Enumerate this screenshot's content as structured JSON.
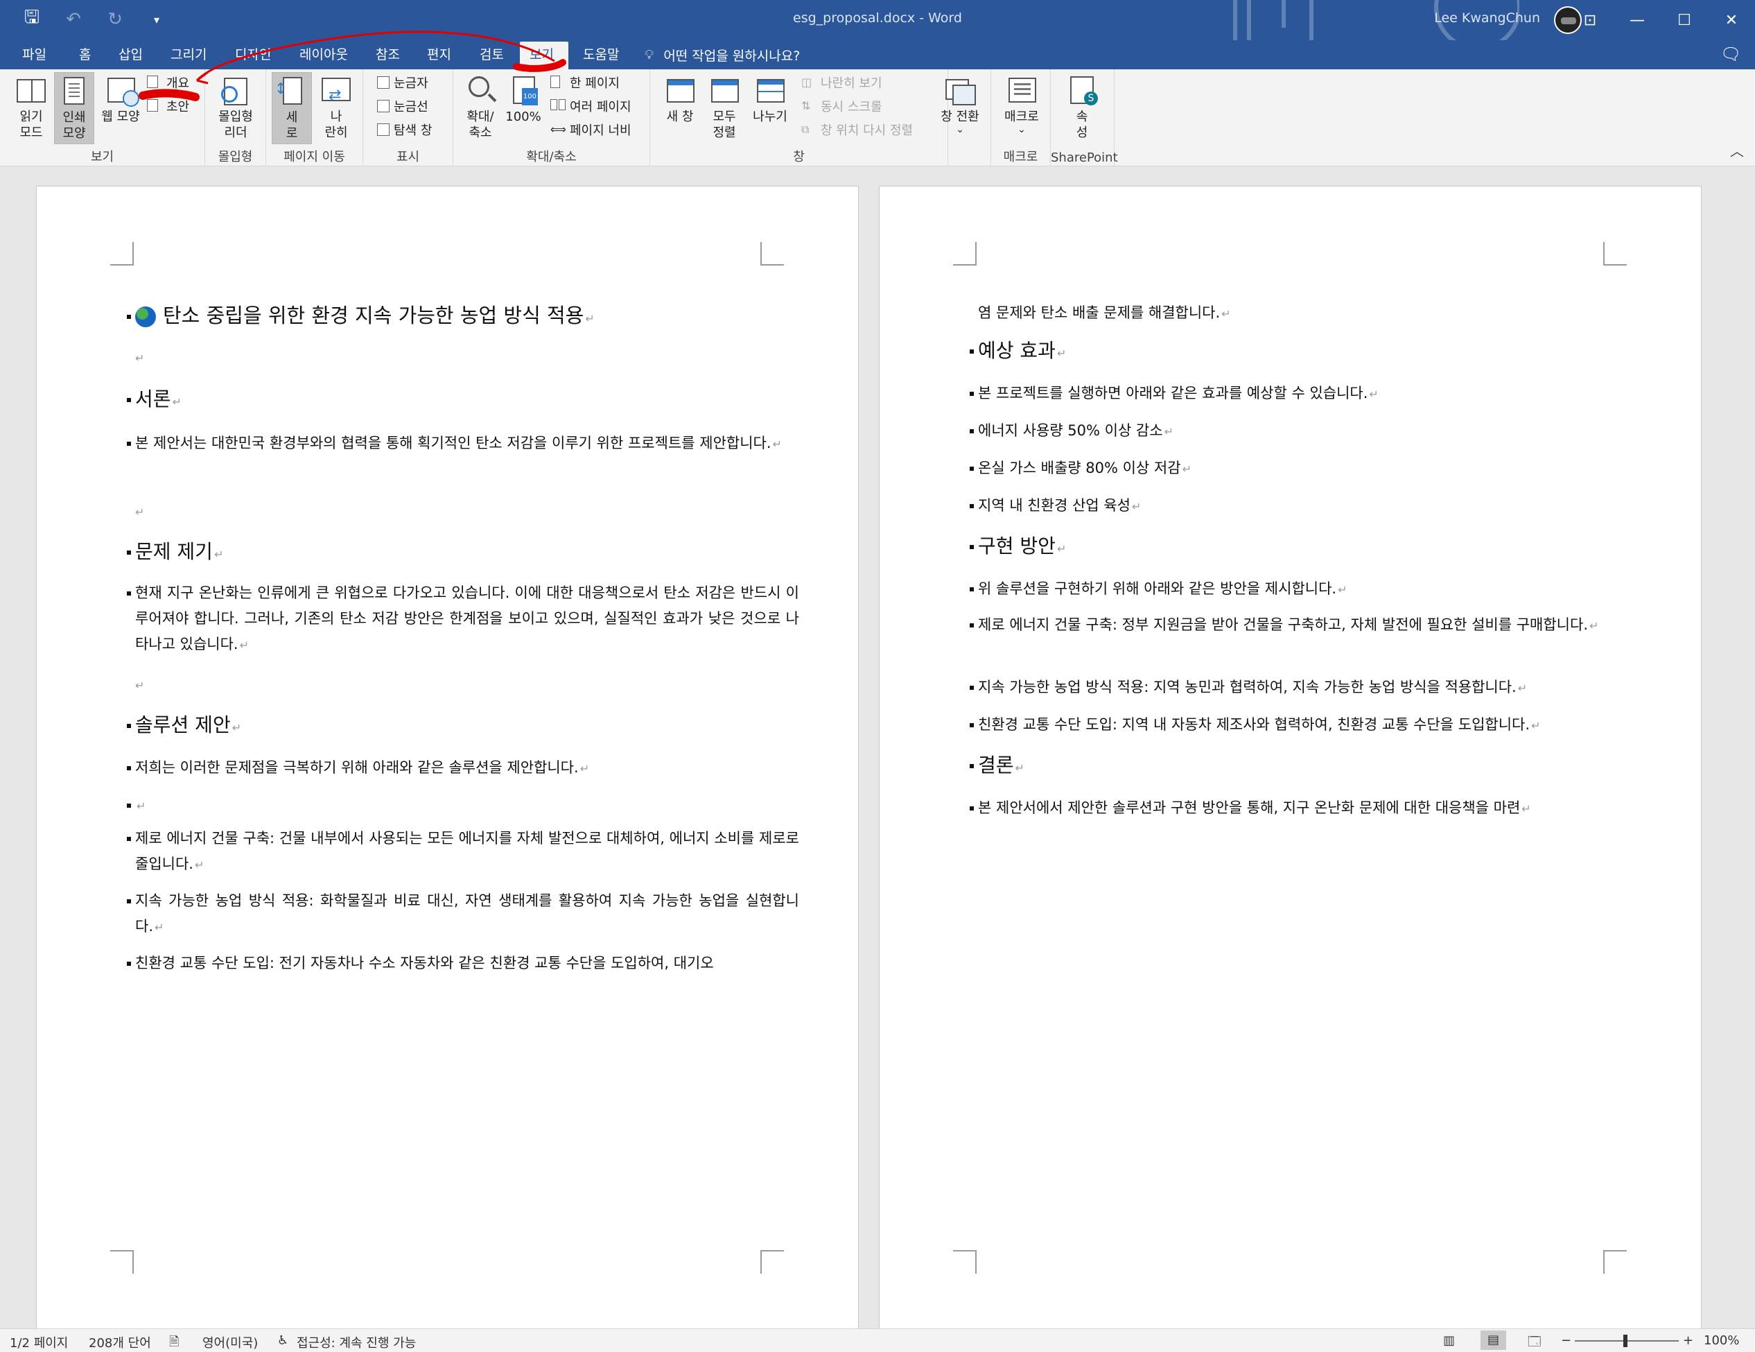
{
  "titlebar": {
    "doc_title": "esg_proposal.docx  -  Word",
    "user_name": "Lee KwangChun",
    "qat": [
      "save-icon",
      "undo-icon",
      "redo-icon",
      "customize-qat-icon"
    ],
    "window_controls": [
      "ribbon-display-options-icon",
      "minimize-icon",
      "maximize-icon",
      "close-icon"
    ]
  },
  "tabs": {
    "items": [
      "파일",
      "홈",
      "삽입",
      "그리기",
      "디자인",
      "레이아웃",
      "참조",
      "편지",
      "검토",
      "보기",
      "도움말"
    ],
    "active": "보기",
    "tell_me": "어떤 작업을 원하시나요?"
  },
  "ribbon": {
    "views": {
      "label": "보기",
      "read_mode": [
        "읽기",
        "모드"
      ],
      "print_layout": [
        "인쇄",
        "모양"
      ],
      "web_layout": "웹 모양",
      "outline": "개요",
      "draft": "초안"
    },
    "immersive": {
      "label": "몰입형",
      "reader": [
        "몰입형",
        "리더"
      ]
    },
    "page_movement": {
      "label": "페이지 이동",
      "vertical": [
        "세",
        "로"
      ],
      "side_by_side": [
        "나",
        "란히"
      ]
    },
    "show": {
      "label": "표시",
      "ruler": "눈금자",
      "gridlines": "눈금선",
      "nav_pane": "탐색 창"
    },
    "zoom": {
      "label": "확대/축소",
      "zoom": [
        "확대/",
        "축소"
      ],
      "hundred": "100%",
      "one_page": "한 페이지",
      "multiple_pages": "여러 페이지",
      "page_width": "페이지 너비"
    },
    "window": {
      "label": "창",
      "new_window": "새 창",
      "arrange_all": [
        "모두",
        "정렬"
      ],
      "split": "나누기",
      "view_side_by_side": "나란히 보기",
      "sync_scroll": "동시 스크롤",
      "reset_position": "창 위치 다시 정렬",
      "switch_windows": [
        "창 전환",
        "⌄"
      ]
    },
    "macros": {
      "label": "매크로",
      "macros": [
        "매크로",
        "⌄"
      ]
    },
    "sharepoint": {
      "label": "SharePoint",
      "properties": [
        "속",
        "성"
      ]
    }
  },
  "page1": {
    "title": "탄소 중립을 위한 환경 지속 가능한 농업 방식 적용",
    "h_intro": "서론",
    "intro": "본 제안서는 대한민국 환경부와의 협력을 통해 획기적인 탄소 저감을 이루기 위한 프로젝트를 제안합니다.",
    "h_problem": "문제 제기",
    "problem": "현재 지구 온난화는 인류에게 큰 위협으로 다가오고 있습니다. 이에 대한 대응책으로서 탄소 저감은 반드시 이루어져야 합니다. 그러나, 기존의 탄소 저감 방안은 한계점을 보이고 있으며, 실질적인 효과가 낮은 것으로 나타나고 있습니다.",
    "h_solution": "솔루션 제안",
    "solution_intro": "저희는 이러한 문제점을 극복하기 위해 아래와 같은 솔루션을 제안합니다.",
    "sol1": "제로 에너지 건물 구축: 건물 내부에서 사용되는 모든 에너지를 자체 발전으로 대체하여, 에너지 소비를 제로로 줄입니다.",
    "sol2": "지속 가능한 농업 방식 적용: 화학물질과 비료 대신, 자연 생태계를 활용하여 지속 가능한 농업을 실현합니다.",
    "sol3": "친환경 교통 수단 도입: 전기 자동차나 수소 자동차와 같은 친환경 교통 수단을 도입하여, 대기오"
  },
  "page2": {
    "cont": "염 문제와 탄소 배출 문제를 해결합니다.",
    "h_effect": "예상 효과",
    "effect_intro": "본 프로젝트를 실행하면 아래와 같은 효과를 예상할 수 있습니다.",
    "e1": "에너지 사용량 50% 이상 감소",
    "e2": "온실 가스 배출량 80% 이상 저감",
    "e3": "지역 내 친환경 산업 육성",
    "h_impl": "구현 방안",
    "impl_intro": "위 솔루션을 구현하기 위해 아래와 같은 방안을 제시합니다.",
    "i1": "제로 에너지 건물 구축: 정부 지원금을 받아 건물을 구축하고, 자체 발전에 필요한 설비를 구매합니다.",
    "i2": "지속 가능한 농업 방식 적용: 지역 농민과 협력하여, 지속 가능한 농업 방식을 적용합니다.",
    "i3": "친환경 교통 수단 도입: 지역 내 자동차 제조사와 협력하여, 친환경 교통 수단을 도입합니다.",
    "h_conc": "결론",
    "conc": "본 제안서에서 제안한 솔루션과 구현 방안을 통해, 지구 온난화 문제에 대한 대응책을 마련"
  },
  "status": {
    "page": "1/2 페이지",
    "words": "208개 단어",
    "language": "영어(미국)",
    "accessibility": "접근성: 계속 진행 가능",
    "zoom": "100%",
    "zoom_minus": "−",
    "zoom_plus": "+"
  },
  "colors": {
    "brand": "#2b579a",
    "annotation": "#e00000"
  }
}
